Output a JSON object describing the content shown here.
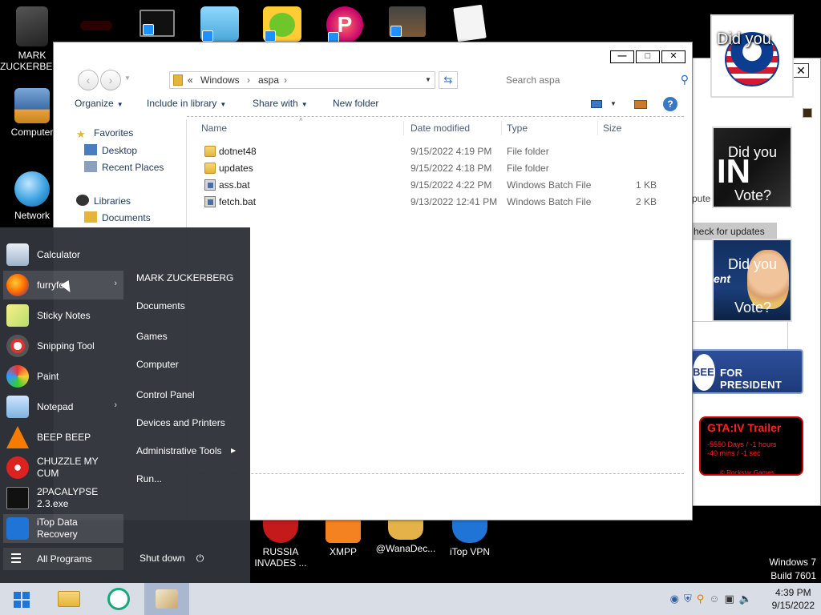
{
  "desktop": {
    "icons_top": [
      {
        "label": "MARK ZUCKERBERG"
      },
      {
        "label": ""
      },
      {
        "label": ""
      },
      {
        "label": ""
      },
      {
        "label": ""
      },
      {
        "label": ""
      },
      {
        "label": ""
      }
    ],
    "icons_left": [
      {
        "label": "Computer"
      },
      {
        "label": "Network"
      }
    ],
    "icons_bottom": [
      {
        "label": "RUSSIA INVADES ..."
      },
      {
        "label": "XMPP"
      },
      {
        "label": "@WanaDec..."
      },
      {
        "label": "iTop VPN"
      }
    ],
    "watermark": {
      "line1": "Windows 7",
      "line2": "Build 7601"
    }
  },
  "background_window": {
    "close_label": "✕",
    "partial_text": "pute",
    "check_updates": "heck for updates"
  },
  "ads": {
    "obama": {
      "text": "Did you"
    },
    "in": {
      "a": "Did you",
      "b": "IN",
      "c": "Vote?"
    },
    "hillary": {
      "a": "Did you",
      "b": "ent",
      "c": "Vote?"
    },
    "bee": {
      "a": "BEE",
      "b": "FOR PRESIDENT"
    },
    "gta": {
      "title": "GTA:IV  Trailer",
      "sub1": "-5550 Days / -1 hours",
      "sub2": "-40 mins / -1 sec",
      "footer": "© Rockstar Games"
    }
  },
  "explorer": {
    "controls": {
      "minimize": "—",
      "maximize": "□",
      "close": "✕"
    },
    "address": {
      "prefix": "«",
      "crumbs": [
        "Windows",
        "aspa"
      ],
      "sep": "›"
    },
    "search": {
      "placeholder": "Search aspa"
    },
    "toolbar": {
      "organize": "Organize",
      "include": "Include in library",
      "share": "Share with",
      "newfolder": "New folder"
    },
    "nav": {
      "favorites": "Favorites",
      "desktop": "Desktop",
      "recent": "Recent Places",
      "libraries": "Libraries",
      "documents": "Documents"
    },
    "columns": {
      "name": "Name",
      "date": "Date modified",
      "type": "Type",
      "size": "Size"
    },
    "files": [
      {
        "name": "dotnet48",
        "date": "9/15/2022 4:19 PM",
        "type": "File folder",
        "size": "",
        "kind": "folder"
      },
      {
        "name": "updates",
        "date": "9/15/2022 4:18 PM",
        "type": "File folder",
        "size": "",
        "kind": "folder"
      },
      {
        "name": "ass.bat",
        "date": "9/15/2022 4:22 PM",
        "type": "Windows Batch File",
        "size": "1 KB",
        "kind": "bat"
      },
      {
        "name": "fetch.bat",
        "date": "9/13/2022 12:41 PM",
        "type": "Windows Batch File",
        "size": "2 KB",
        "kind": "bat"
      }
    ]
  },
  "start_menu": {
    "programs": [
      {
        "label": "Calculator"
      },
      {
        "label": "furryfox"
      },
      {
        "label": "Sticky Notes"
      },
      {
        "label": "Snipping Tool"
      },
      {
        "label": "Paint"
      },
      {
        "label": "Notepad"
      },
      {
        "label": "BEEP BEEP"
      },
      {
        "label1": "CHUZZLE MY",
        "label2": "CUM"
      },
      {
        "label1": "2PACALYPSE",
        "label2": "2.3.exe"
      },
      {
        "label1": "iTop Data",
        "label2": "Recovery"
      }
    ],
    "all_programs": "All Programs",
    "right": {
      "user": "MARK ZUCKERBERG",
      "documents": "Documents",
      "games": "Games",
      "computer": "Computer",
      "control_panel": "Control Panel",
      "devices": "Devices and Printers",
      "admin": "Administrative Tools",
      "run": "Run..."
    },
    "shutdown": "Shut down"
  },
  "taskbar": {
    "clock_time": "4:39 PM",
    "clock_date": "9/15/2022"
  }
}
